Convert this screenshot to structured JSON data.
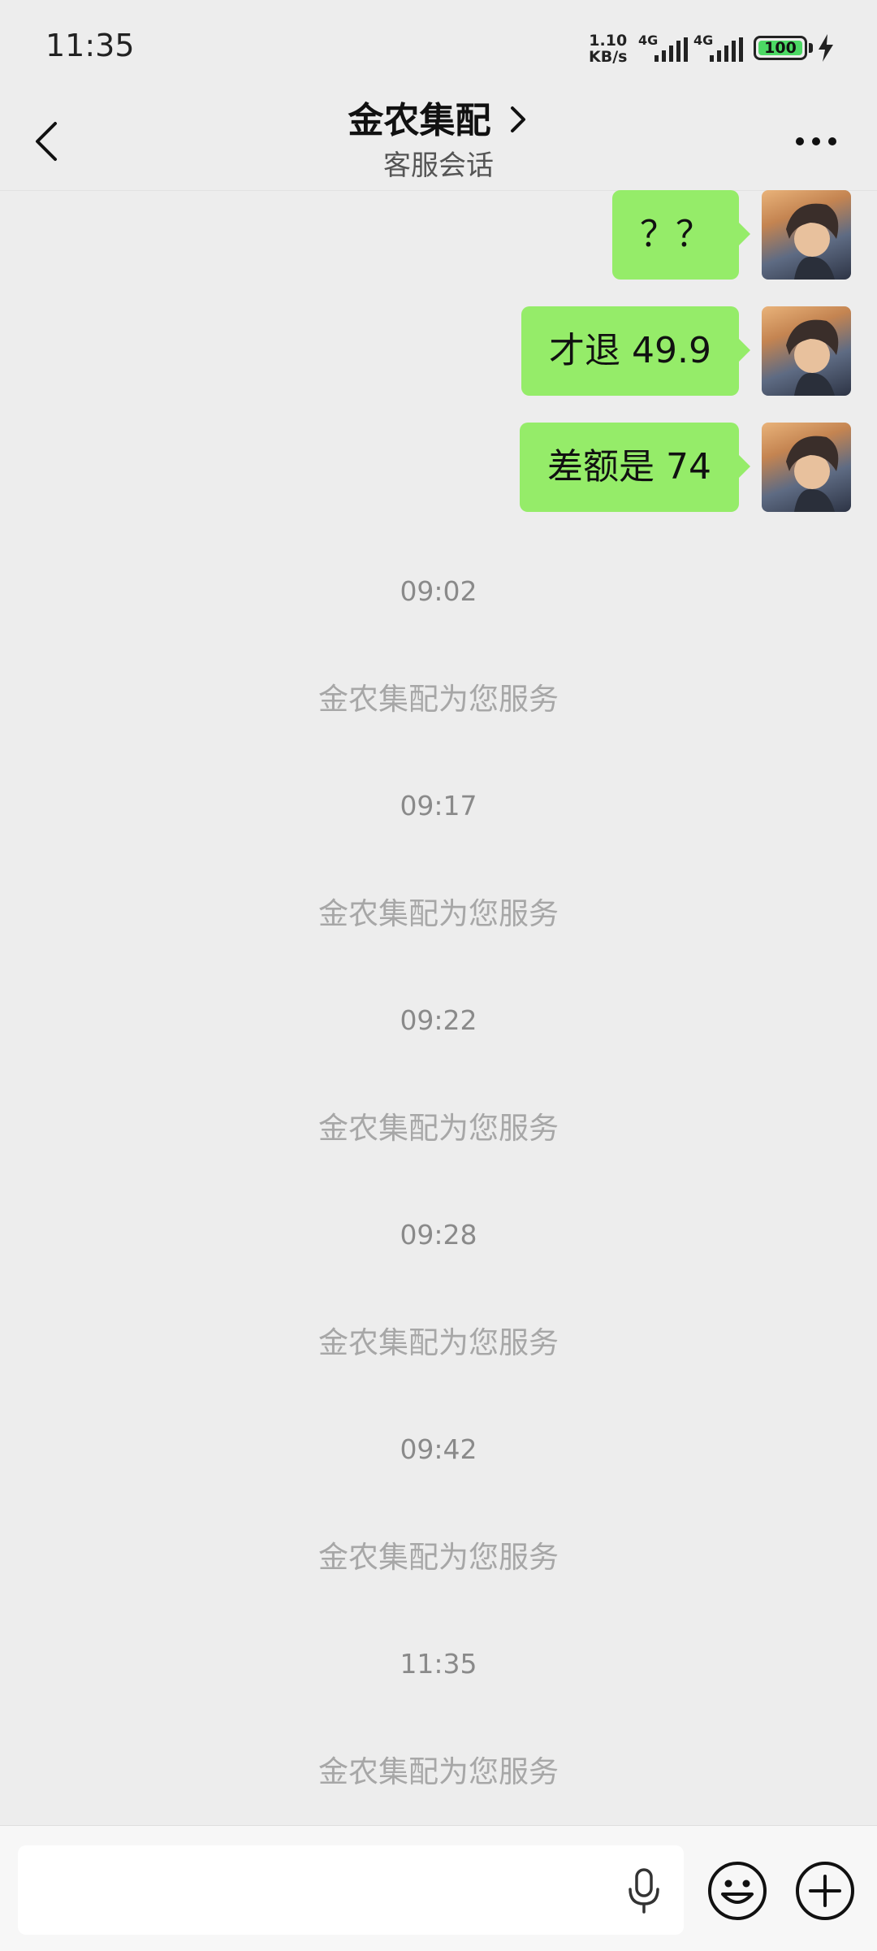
{
  "status_bar": {
    "time": "11:35",
    "net_speed_value": "1.10",
    "net_speed_unit": "KB/s",
    "signal1_label": "4G",
    "signal2_label": "4G",
    "battery_level": "100"
  },
  "header": {
    "title": "金农集配",
    "subtitle": "客服会话"
  },
  "messages": [
    {
      "text": "？？"
    },
    {
      "text": "才退 49.9"
    },
    {
      "text": "差额是 74"
    }
  ],
  "system_messages": [
    {
      "time": "09:02",
      "note": "金农集配为您服务"
    },
    {
      "time": "09:17",
      "note": "金农集配为您服务"
    },
    {
      "time": "09:22",
      "note": "金农集配为您服务"
    },
    {
      "time": "09:28",
      "note": "金农集配为您服务"
    },
    {
      "time": "09:42",
      "note": "金农集配为您服务"
    },
    {
      "time": "11:35",
      "note": "金农集配为您服务"
    }
  ],
  "input": {
    "value": "",
    "placeholder": ""
  },
  "colors": {
    "bubble": "#95ec69",
    "background": "#ededed",
    "battery": "#4cd964"
  }
}
